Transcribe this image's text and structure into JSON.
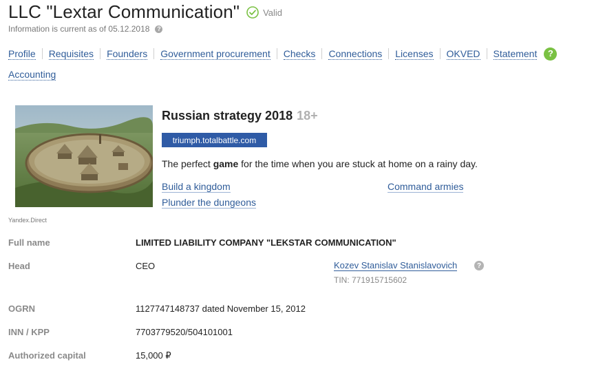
{
  "header": {
    "company_title": "LLC \"Lextar Communication\"",
    "status": "Valid",
    "info_text": "Information is current as of 05.12.2018",
    "help_symbol": "?"
  },
  "nav": {
    "items": [
      "Profile",
      "Requisites",
      "Founders",
      "Government procurement",
      "Checks",
      "Connections",
      "Licenses",
      "OKVED",
      "Statement",
      "Accounting"
    ],
    "help_symbol": "?"
  },
  "ad": {
    "title": "Russian strategy 2018",
    "age_rating": "18+",
    "domain": "triumph.totalbattle.com",
    "desc_before": "The perfect ",
    "desc_bold": "game",
    "desc_after": " for the time when you are stuck at home on a rainy day.",
    "links": [
      "Build a kingdom",
      "Command armies",
      "Plunder the dungeons"
    ],
    "source": "Yandex.Direct"
  },
  "details": {
    "full_name_label": "Full name",
    "full_name_value": "LIMITED LIABILITY COMPANY \"LEKSTAR COMMUNICATION\"",
    "head_label": "Head",
    "head_position": "CEO",
    "head_name": "Kozev Stanislav Stanislavovich",
    "head_help": "?",
    "head_tin": "TIN: 771915715602",
    "ogrn_label": "OGRN",
    "ogrn_value": "1127747148737 dated November 15, 2012",
    "inn_label": "INN / KPP",
    "inn_value": "7703779520/504101001",
    "capital_label": "Authorized capital",
    "capital_value": "15,000 ₽"
  },
  "colors": {
    "link": "#2f5c99",
    "valid_green": "#7ac143",
    "domain_button": "#2f5ba6",
    "label_gray": "#8a8a8a"
  },
  "icons": {
    "valid": "check-circle-icon",
    "info_help": "question-circle-icon",
    "nav_help": "question-circle-green-icon"
  }
}
